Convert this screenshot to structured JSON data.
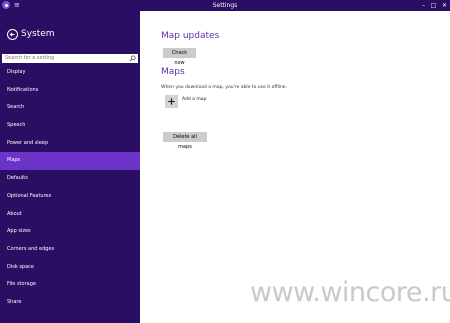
{
  "window": {
    "title": "Settings",
    "controls": {
      "minimize": "–",
      "maximize": "□",
      "close": "✕"
    },
    "menu_glyph": "≡"
  },
  "sidebar": {
    "title": "System",
    "search_placeholder": "Search for a setting",
    "items": [
      {
        "label": "Display",
        "selected": false
      },
      {
        "label": "Notifications",
        "selected": false
      },
      {
        "label": "Search",
        "selected": false
      },
      {
        "label": "Speech",
        "selected": false
      },
      {
        "label": "Power and sleep",
        "selected": false
      },
      {
        "label": "Maps",
        "selected": true
      },
      {
        "label": "Defaults",
        "selected": false
      },
      {
        "label": "Optional Features",
        "selected": false
      },
      {
        "label": "About",
        "selected": false
      },
      {
        "label": "App sizes",
        "selected": false
      },
      {
        "label": "Corners and edges",
        "selected": false
      },
      {
        "label": "Disk space",
        "selected": false
      },
      {
        "label": "File storage",
        "selected": false
      },
      {
        "label": "Share",
        "selected": false
      }
    ]
  },
  "main": {
    "map_updates_heading": "Map updates",
    "check_now_label": "Check now",
    "maps_heading": "Maps",
    "maps_description": "When you download a map, you're able to use it offline.",
    "add_map_label": "Add a map",
    "delete_all_label": "Delete all maps"
  },
  "watermark": "www.wincore.ru",
  "colors": {
    "sidebar_bg": "#2a0e63",
    "selected_bg": "#6b33c8",
    "accent": "#5a2fb5",
    "button_bg": "#cccccc"
  },
  "icons": {
    "app": "settings-app-icon",
    "back": "back-arrow-icon",
    "search": "search-icon",
    "add": "plus-icon"
  }
}
